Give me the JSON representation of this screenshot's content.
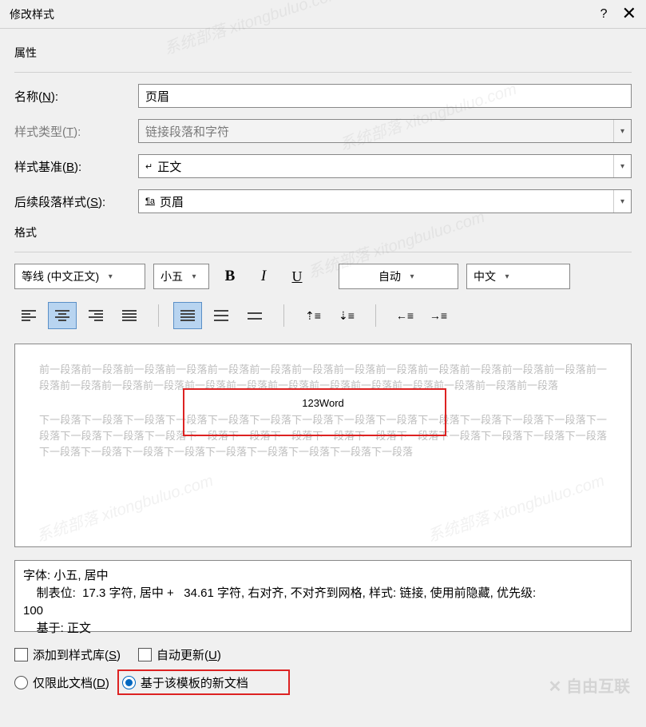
{
  "titlebar": {
    "title": "修改样式",
    "help": "?",
    "close": "✕"
  },
  "sections": {
    "properties": "属性",
    "format": "格式"
  },
  "labels": {
    "name_pre": "名称(",
    "name_ul": "N",
    "name_post": "):",
    "type_pre": "样式类型(",
    "type_ul": "T",
    "type_post": "):",
    "based_pre": "样式基准(",
    "based_ul": "B",
    "based_post": "):",
    "next_pre": "后续段落样式(",
    "next_ul": "S",
    "next_post": "):"
  },
  "values": {
    "name": "页眉",
    "type": "链接段落和字符",
    "based": "正文",
    "next": "页眉"
  },
  "fmt": {
    "font": "等线 (中文正文)",
    "size": "小五",
    "bold": "B",
    "italic": "I",
    "underline": "U",
    "color": "自动",
    "lang": "中文"
  },
  "preview": {
    "before": "前一段落前一段落前一段落前一段落前一段落前一段落前一段落前一段落前一段落前一段落前一段落前一段落前一段落前一段落前一段落前一段落前一段落前一段落前一段落前一段落前一段落前一段落前一段落前一段落前一段落前一段落",
    "sample": "123Word",
    "after": "下一段落下一段落下一段落下一段落下一段落下一段落下一段落下一段落下一段落下一段落下一段落下一段落下一段落下一段落下一段落下一段落下一段落下一段落下一段落下一段落下一段落下一段落下一段落下一段落下一段落下一段落下一段落下一段落下一段落下一段落下一段落下一段落下一段落下一段落下一段落下一段落"
  },
  "description": {
    "line1": "字体: 小五, 居中",
    "line2": "    制表位:  17.3 字符, 居中 +   34.61 字符, 右对齐, 不对齐到网格, 样式: 链接, 使用前隐藏, 优先级:",
    "line3": "100",
    "line4": "    基于: 正文"
  },
  "checks": {
    "add_pre": "添加到样式库(",
    "add_ul": "S",
    "add_post": ")",
    "auto_pre": "自动更新(",
    "auto_ul": "U",
    "auto_post": ")"
  },
  "radios": {
    "only_pre": "仅限此文档(",
    "only_ul": "D",
    "only_post": ")",
    "template": "基于该模板的新文档"
  },
  "watermark": "系统部落 xitongbuluo.com",
  "wm_logo": "✕ 自由互联"
}
